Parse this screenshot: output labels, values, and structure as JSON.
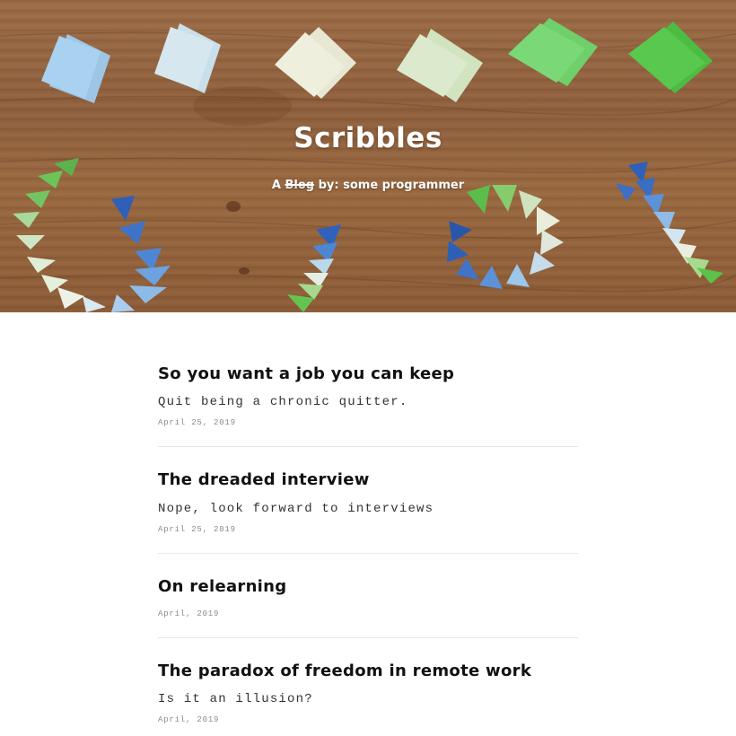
{
  "header": {
    "title": "Scribbles",
    "subtitle_prefix": "A",
    "subtitle_struck": "Blog",
    "subtitle_suffix": "by: some programmer"
  },
  "posts": [
    {
      "title": "So you want a job you can keep",
      "subtitle": "Quit being a chronic quitter.",
      "date": "April 25, 2019"
    },
    {
      "title": "The dreaded interview",
      "subtitle": "Nope, look forward to interviews",
      "date": "April 25, 2019"
    },
    {
      "title": "On relearning",
      "subtitle": "",
      "date": "April, 2019"
    },
    {
      "title": "The paradox of freedom in remote work",
      "subtitle": "Is it an illusion?",
      "date": "April, 2019"
    }
  ]
}
